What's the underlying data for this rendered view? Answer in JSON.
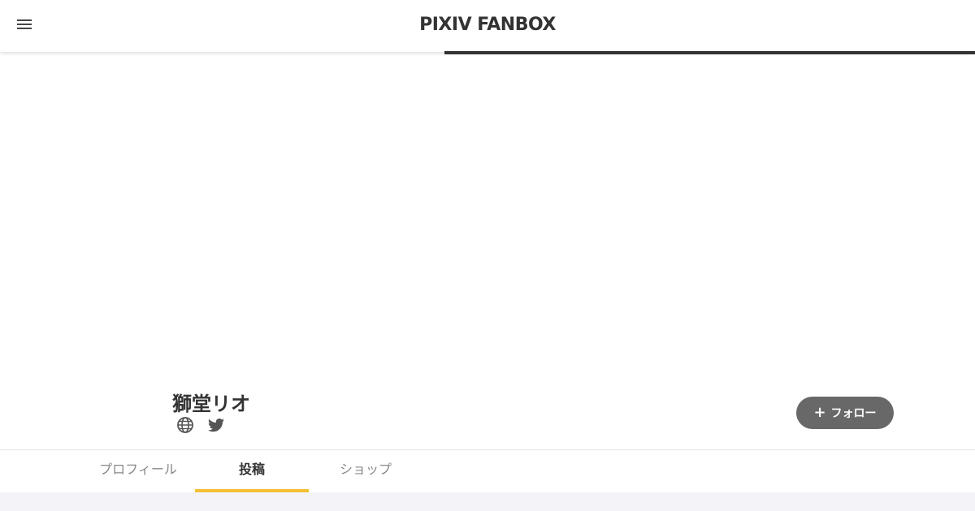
{
  "header": {
    "menu_icon": "hamburger-menu-icon",
    "logo_text": "PIXIV FANBOX"
  },
  "creator": {
    "name": "獅堂リオ",
    "links": [
      {
        "icon": "globe-icon"
      },
      {
        "icon": "twitter-icon"
      }
    ]
  },
  "follow": {
    "icon": "plus-icon",
    "label": "フォロー"
  },
  "tabs": [
    {
      "label": "プロフィール",
      "active": false
    },
    {
      "label": "投稿",
      "active": true
    },
    {
      "label": "ショップ",
      "active": false
    }
  ],
  "colors": {
    "accent": "#f5c034",
    "follow_button": "#686868",
    "loading_bar": "#333333",
    "content_background": "#f4f4f8"
  },
  "loading_progress": 0.54
}
